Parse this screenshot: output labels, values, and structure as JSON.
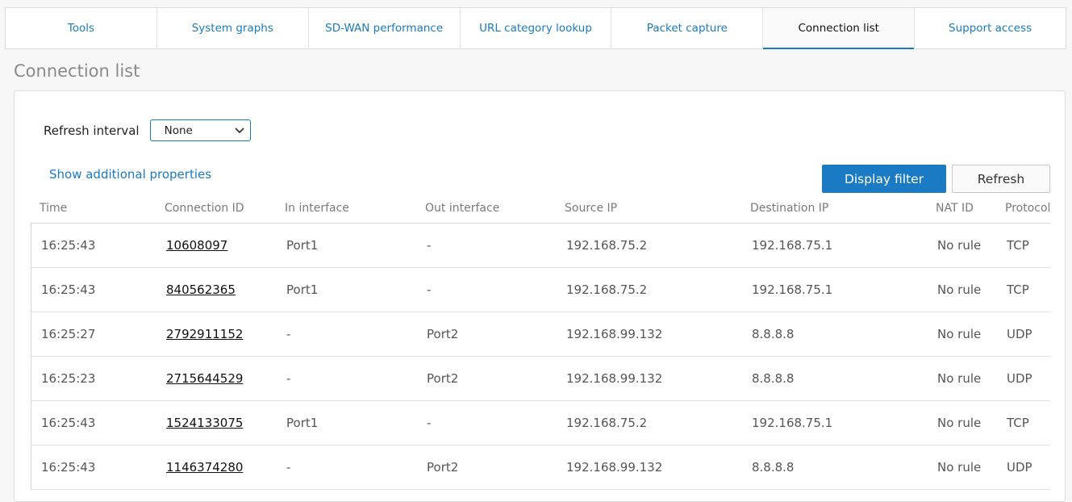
{
  "tabs": [
    {
      "label": "Tools",
      "active": false
    },
    {
      "label": "System graphs",
      "active": false
    },
    {
      "label": "SD-WAN performance",
      "active": false
    },
    {
      "label": "URL category lookup",
      "active": false
    },
    {
      "label": "Packet capture",
      "active": false
    },
    {
      "label": "Connection list",
      "active": true
    },
    {
      "label": "Support access",
      "active": false
    }
  ],
  "page": {
    "title": "Connection list"
  },
  "controls": {
    "refresh_label": "Refresh interval",
    "refresh_value": "None",
    "show_props": "Show additional properties",
    "display_filter": "Display filter",
    "refresh_button": "Refresh"
  },
  "table": {
    "headers": {
      "time": "Time",
      "id": "Connection ID",
      "in": "In interface",
      "out": "Out interface",
      "src": "Source IP",
      "dst": "Destination IP",
      "nat": "NAT ID",
      "proto": "Protocol"
    },
    "rows": [
      {
        "time": "16:25:43",
        "id": "10608097",
        "in": "Port1",
        "out": "-",
        "src": "192.168.75.2",
        "dst": "192.168.75.1",
        "nat": "No rule",
        "proto": "TCP"
      },
      {
        "time": "16:25:43",
        "id": "840562365",
        "in": "Port1",
        "out": "-",
        "src": "192.168.75.2",
        "dst": "192.168.75.1",
        "nat": "No rule",
        "proto": "TCP"
      },
      {
        "time": "16:25:27",
        "id": "2792911152",
        "in": "-",
        "out": "Port2",
        "src": "192.168.99.132",
        "dst": "8.8.8.8",
        "nat": "No rule",
        "proto": "UDP"
      },
      {
        "time": "16:25:23",
        "id": "2715644529",
        "in": "-",
        "out": "Port2",
        "src": "192.168.99.132",
        "dst": "8.8.8.8",
        "nat": "No rule",
        "proto": "UDP"
      },
      {
        "time": "16:25:43",
        "id": "1524133075",
        "in": "Port1",
        "out": "-",
        "src": "192.168.75.2",
        "dst": "192.168.75.1",
        "nat": "No rule",
        "proto": "TCP"
      },
      {
        "time": "16:25:43",
        "id": "1146374280",
        "in": "-",
        "out": "Port2",
        "src": "192.168.99.132",
        "dst": "8.8.8.8",
        "nat": "No rule",
        "proto": "UDP"
      }
    ]
  },
  "colors": {
    "accent": "#1a7bc4",
    "title_gray": "#8a8a8a"
  }
}
